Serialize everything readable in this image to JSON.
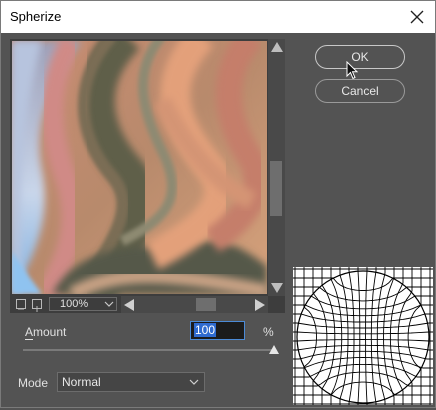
{
  "dialog": {
    "title": "Spherize",
    "close_icon": "close-icon"
  },
  "preview": {
    "zoom": "100%",
    "icons": {
      "zoom_out": "zoom-out-icon",
      "zoom_in": "zoom-in-icon",
      "zoom_dropdown": "chevron-down-icon",
      "scroll_up": "arrow-up-icon",
      "scroll_down": "arrow-down-icon",
      "scroll_left": "arrow-left-icon",
      "scroll_right": "arrow-right-icon"
    },
    "vertical_scroll_position": 0.5,
    "horizontal_scroll_position": 0.5
  },
  "buttons": {
    "ok": "OK",
    "cancel": "Cancel"
  },
  "amount": {
    "label": "Amount",
    "value": "100",
    "unit": "%",
    "slider_value": 100,
    "slider_min": -100,
    "slider_max": 100
  },
  "mode": {
    "label": "Mode",
    "selected": "Normal"
  },
  "colors": {
    "dialog_bg": "#535353",
    "input_focus": "#4b8ad6",
    "selection": "#2f6bd0"
  }
}
